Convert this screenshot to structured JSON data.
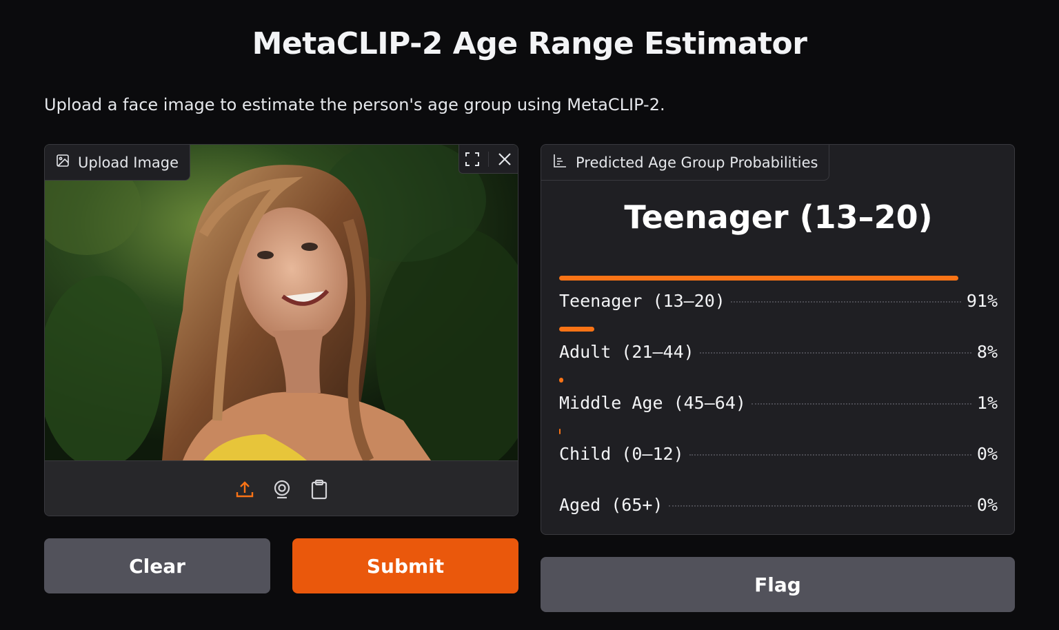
{
  "header": {
    "title": "MetaCLIP-2 Age Range Estimator",
    "description": "Upload a face image to estimate the person's age group using MetaCLIP-2."
  },
  "input": {
    "tab_label": "Upload Image",
    "tab_icon": "image-icon",
    "controls": [
      "fullscreen-icon",
      "close-icon"
    ],
    "sources": [
      "upload-icon",
      "webcam-icon",
      "clipboard-icon"
    ],
    "active_color": "#f97316"
  },
  "output": {
    "tab_label": "Predicted Age Group Probabilities",
    "tab_icon": "chart-icon",
    "top_label": "Teenager (13–20)",
    "confidences": [
      {
        "label": "Teenager (13–20)",
        "value": "91%",
        "fraction": 0.91
      },
      {
        "label": "Adult (21–44)",
        "value": "8%",
        "fraction": 0.08
      },
      {
        "label": "Middle Age (45–64)",
        "value": "1%",
        "fraction": 0.01
      },
      {
        "label": "Child (0–12)",
        "value": "0%",
        "fraction": 0.003
      },
      {
        "label": "Aged (65+)",
        "value": "0%",
        "fraction": 0.0
      }
    ]
  },
  "buttons": {
    "clear": "Clear",
    "submit": "Submit",
    "flag": "Flag"
  },
  "colors": {
    "accent": "#ea580c",
    "bar": "#f97316",
    "secondary_button": "#52525b",
    "background": "#0b0b0d"
  }
}
